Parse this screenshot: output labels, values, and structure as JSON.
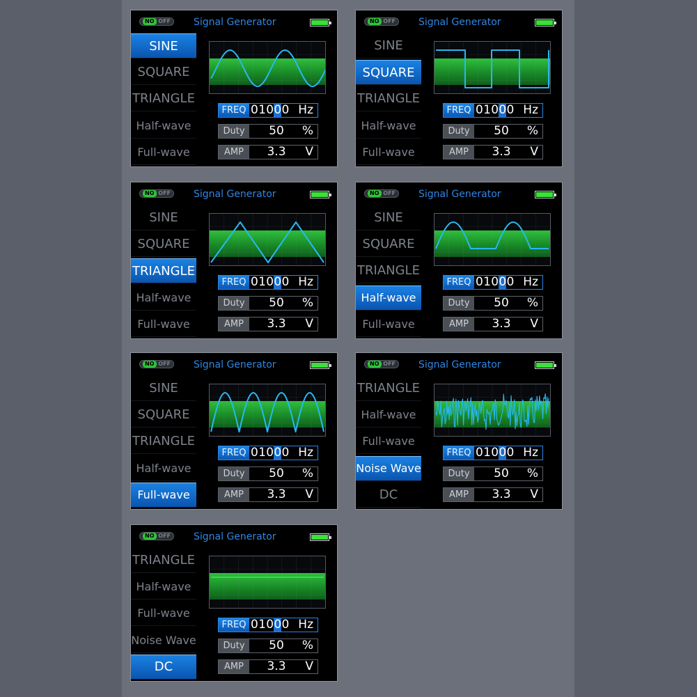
{
  "colors": {
    "accent_blue": "#2f86e3",
    "wave_stroke": "#29b8f2",
    "band_green": "#1f9b2e",
    "battery_green": "#3be03a"
  },
  "common": {
    "toggle_on": "NO",
    "toggle_off": "OFF",
    "title": "Signal Generator",
    "battery_text": "",
    "freq_label": "FREQ",
    "freq_digits_pre": "010",
    "freq_digit_cursor": "0",
    "freq_digits_post": "0",
    "freq_unit": "Hz",
    "duty_label": "Duty",
    "duty_value": "50",
    "duty_unit": "%",
    "amp_label": "AMP",
    "amp_value": "3.3",
    "amp_unit": "V"
  },
  "panels": [
    {
      "selected": "SINE",
      "waveform": "sine",
      "menu": [
        "SINE",
        "SQUARE",
        "TRIANGLE",
        "Half-wave",
        "Full-wave"
      ]
    },
    {
      "selected": "SQUARE",
      "waveform": "square",
      "menu": [
        "SINE",
        "SQUARE",
        "TRIANGLE",
        "Half-wave",
        "Full-wave"
      ]
    },
    {
      "selected": "TRIANGLE",
      "waveform": "triangle",
      "menu": [
        "SINE",
        "SQUARE",
        "TRIANGLE",
        "Half-wave",
        "Full-wave"
      ]
    },
    {
      "selected": "Half-wave",
      "waveform": "half-wave",
      "menu": [
        "SINE",
        "SQUARE",
        "TRIANGLE",
        "Half-wave",
        "Full-wave"
      ]
    },
    {
      "selected": "Full-wave",
      "waveform": "full-wave",
      "menu": [
        "SINE",
        "SQUARE",
        "TRIANGLE",
        "Half-wave",
        "Full-wave"
      ]
    },
    {
      "selected": "Noise Wave",
      "waveform": "noise",
      "menu": [
        "TRIANGLE",
        "Half-wave",
        "Full-wave",
        "Noise Wave",
        "DC"
      ]
    },
    {
      "selected": "DC",
      "waveform": "dc",
      "menu": [
        "TRIANGLE",
        "Half-wave",
        "Full-wave",
        "Noise Wave",
        "DC"
      ]
    }
  ]
}
